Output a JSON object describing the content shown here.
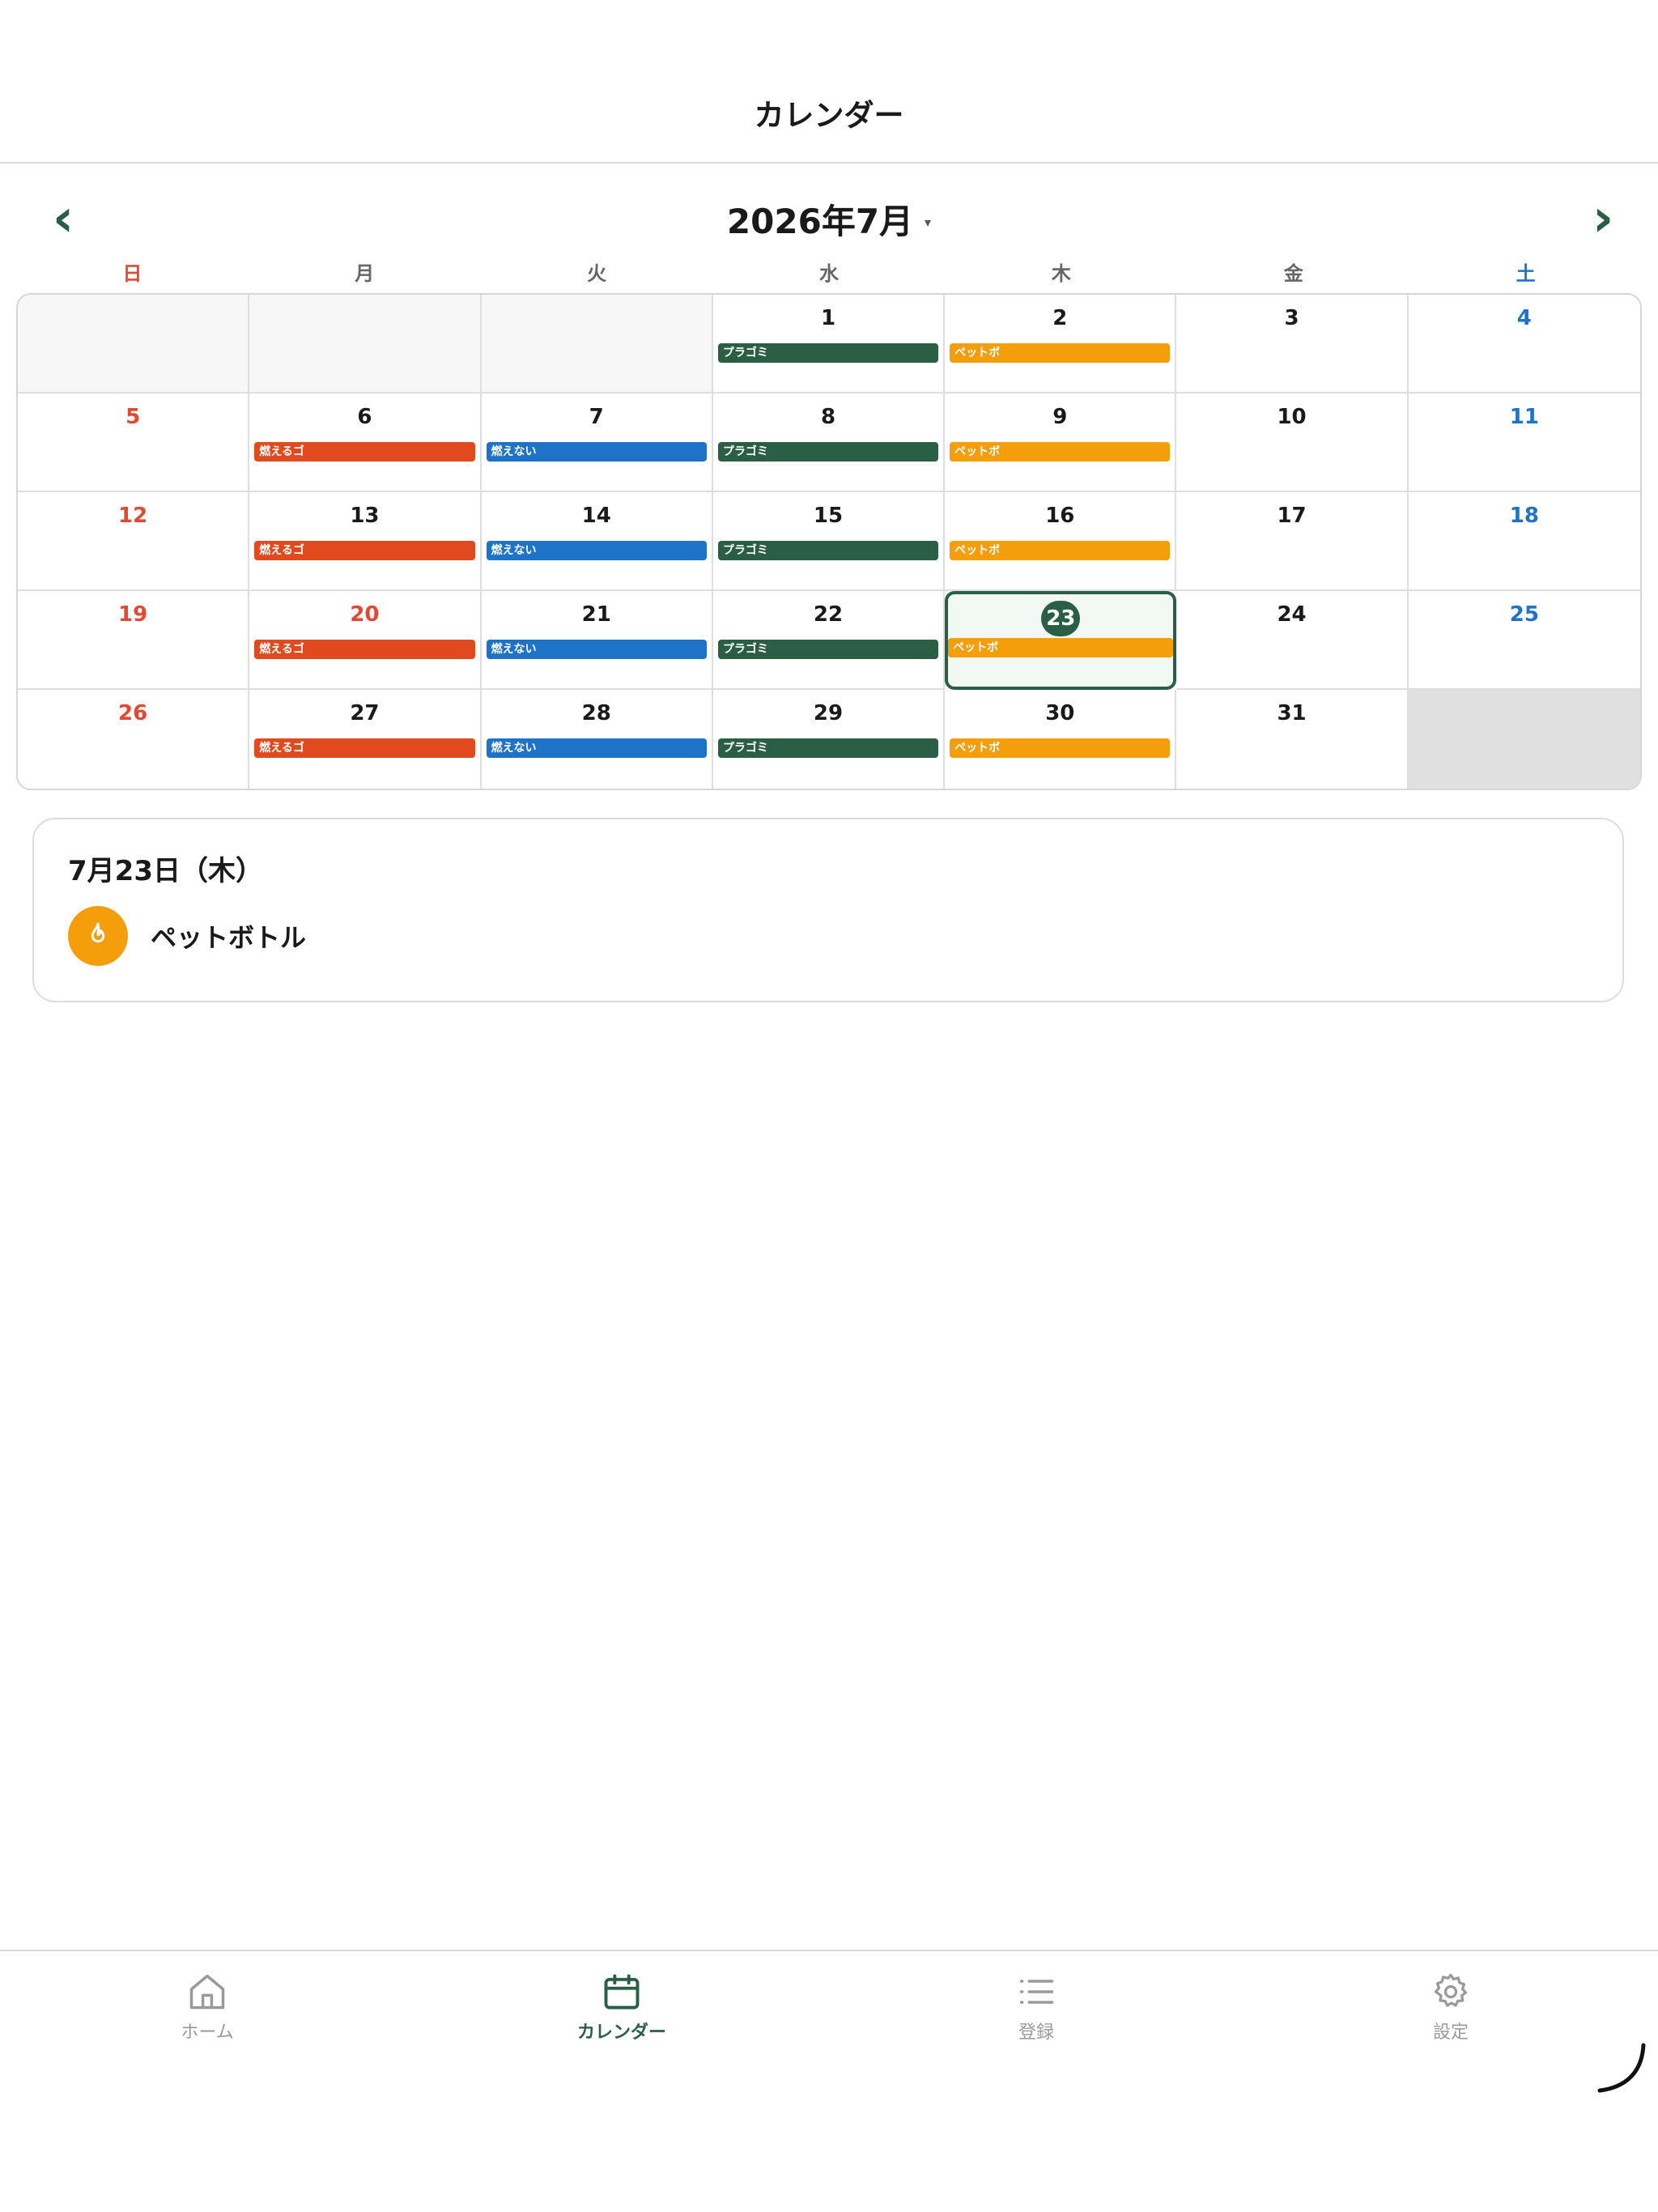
{
  "header": {
    "title": "カレンダー"
  },
  "month_nav": {
    "prev": "‹",
    "next": "›",
    "title": "2026年7月",
    "caret": "▾"
  },
  "weekdays": [
    "日",
    "月",
    "火",
    "水",
    "木",
    "金",
    "土"
  ],
  "calendar": {
    "weeks": [
      [
        {
          "day": ""
        },
        {
          "day": ""
        },
        {
          "day": ""
        },
        {
          "day": "1",
          "tag": "プラゴミ",
          "color": "green"
        },
        {
          "day": "2",
          "tag": "ペットボ",
          "color": "orange"
        },
        {
          "day": "3"
        },
        {
          "day": "4"
        }
      ],
      [
        {
          "day": "5"
        },
        {
          "day": "6",
          "tag": "燃えるゴ",
          "color": "red"
        },
        {
          "day": "7",
          "tag": "燃えない",
          "color": "blue"
        },
        {
          "day": "8",
          "tag": "プラゴミ",
          "color": "green"
        },
        {
          "day": "9",
          "tag": "ペットボ",
          "color": "orange"
        },
        {
          "day": "10"
        },
        {
          "day": "11"
        }
      ],
      [
        {
          "day": "12"
        },
        {
          "day": "13",
          "tag": "燃えるゴ",
          "color": "red"
        },
        {
          "day": "14",
          "tag": "燃えない",
          "color": "blue"
        },
        {
          "day": "15",
          "tag": "プラゴミ",
          "color": "green"
        },
        {
          "day": "16",
          "tag": "ペットボ",
          "color": "orange"
        },
        {
          "day": "17"
        },
        {
          "day": "18"
        }
      ],
      [
        {
          "day": "19"
        },
        {
          "day": "20",
          "tag": "燃えるゴ",
          "color": "red",
          "holiday": true
        },
        {
          "day": "21",
          "tag": "燃えない",
          "color": "blue"
        },
        {
          "day": "22",
          "tag": "プラゴミ",
          "color": "green"
        },
        {
          "day": "23",
          "tag": "ペットボ",
          "color": "orange",
          "selected": true
        },
        {
          "day": "24"
        },
        {
          "day": "25"
        }
      ],
      [
        {
          "day": "26"
        },
        {
          "day": "27",
          "tag": "燃えるゴ",
          "color": "red"
        },
        {
          "day": "28",
          "tag": "燃えない",
          "color": "blue"
        },
        {
          "day": "29",
          "tag": "プラゴミ",
          "color": "green"
        },
        {
          "day": "30",
          "tag": "ペットボ",
          "color": "orange"
        },
        {
          "day": "31"
        },
        {
          "day": ""
        }
      ]
    ]
  },
  "detail": {
    "date": "7月23日（木）",
    "items": [
      {
        "label": "ペットボトル",
        "icon": "flame-icon"
      }
    ]
  },
  "tabbar": {
    "tabs": [
      {
        "label": "ホーム",
        "icon": "home-icon"
      },
      {
        "label": "カレンダー",
        "icon": "calendar-icon",
        "active": true
      },
      {
        "label": "登録",
        "icon": "list-icon"
      },
      {
        "label": "設定",
        "icon": "gear-icon"
      }
    ]
  },
  "colors": {
    "accent": "#2b5f45",
    "burnable": "#e04a1e",
    "non_burnable": "#1e73c8",
    "plastic": "#2b5f45",
    "pet_bottle": "#f59e0b",
    "sunday": "#e04a32",
    "saturday": "#1e73c8"
  }
}
